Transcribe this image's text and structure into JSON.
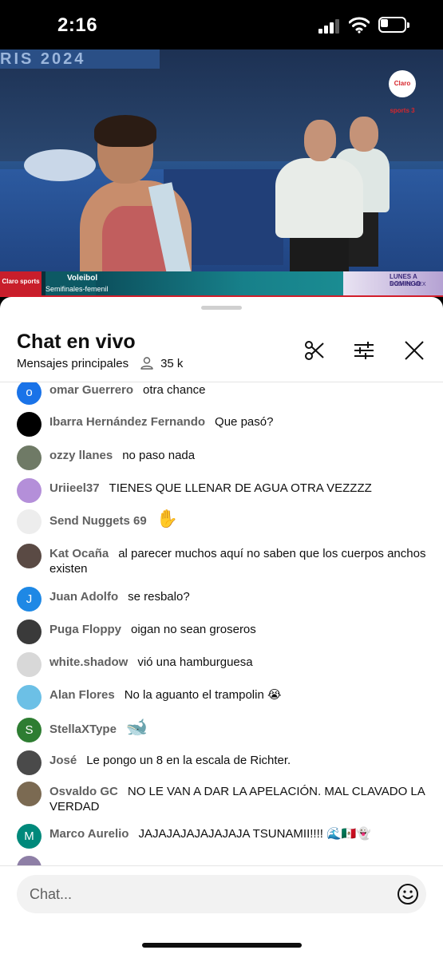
{
  "status_bar": {
    "time": "2:16",
    "battery_level": 0.35,
    "signal_bars": 3
  },
  "video": {
    "background_banner": "RIS 2024",
    "channel_logo": "Claro sports 3",
    "ticker": {
      "logo": "Claro sports",
      "sport": "Voleibol",
      "event": "Semifinales-femenil",
      "promo_title": "LUNES A DOMINGO",
      "promo_subtitle": "9:00HRS MEX"
    }
  },
  "chat": {
    "title": "Chat en vivo",
    "mode": "Mensajes principales",
    "viewer_count": "35 k",
    "input_placeholder": "Chat...",
    "messages": [
      {
        "author": "omar Guerrero",
        "text": "otra chance",
        "avatar_letter": "o",
        "avatar_color": "#1a73e8"
      },
      {
        "author": "Ibarra Hernández Fernando",
        "text": "Que pasó?",
        "avatar_letter": "",
        "avatar_color": "#000000"
      },
      {
        "author": "ozzy llanes",
        "text": "no paso nada",
        "avatar_letter": "",
        "avatar_color": "#6f7a66"
      },
      {
        "author": "Uriieel37",
        "text": "TIENES QUE LLENAR DE AGUA OTRA VEZZZZ",
        "avatar_letter": "",
        "avatar_color": "#b48fd9"
      },
      {
        "author": "Send Nuggets 69",
        "text": "",
        "emoji": "✋",
        "avatar_letter": "",
        "avatar_color": "#ededed"
      },
      {
        "author": "Kat Ocaña",
        "text": "al parecer muchos aquí no saben que los cuerpos anchos existen",
        "avatar_letter": "",
        "avatar_color": "#5a4a44"
      },
      {
        "author": "Juan Adolfo",
        "text": "se resbalo?",
        "avatar_letter": "J",
        "avatar_color": "#1e88e5"
      },
      {
        "author": "Puga Floppy",
        "text": "oigan no sean groseros",
        "avatar_letter": "",
        "avatar_color": "#3a3a3a"
      },
      {
        "author": "white.shadow",
        "text": "vió una hamburguesa",
        "avatar_letter": "",
        "avatar_color": "#d8d8d8"
      },
      {
        "author": "Alan Flores",
        "text": "No la aguanto el trampolin 😭",
        "avatar_letter": "",
        "avatar_color": "#6cc0e6"
      },
      {
        "author": "StellaXType",
        "text": "",
        "emoji": "🐋",
        "avatar_letter": "S",
        "avatar_color": "#2e7d32"
      },
      {
        "author": "José",
        "text": "Le pongo un 8 en la escala de Richter.",
        "avatar_letter": "",
        "avatar_color": "#4a4a4a"
      },
      {
        "author": "Osvaldo GC",
        "text": "NO LE VAN A DAR LA APELACIÓN. MAL CLAVADO LA VERDAD",
        "avatar_letter": "",
        "avatar_color": "#7b6a52"
      },
      {
        "author": "Marco Aurelio",
        "text": "JAJAJAJAJAJAJAJA TSUNAMII!!!! 🌊🇲🇽👻",
        "avatar_letter": "M",
        "avatar_color": "#00897b"
      }
    ]
  }
}
